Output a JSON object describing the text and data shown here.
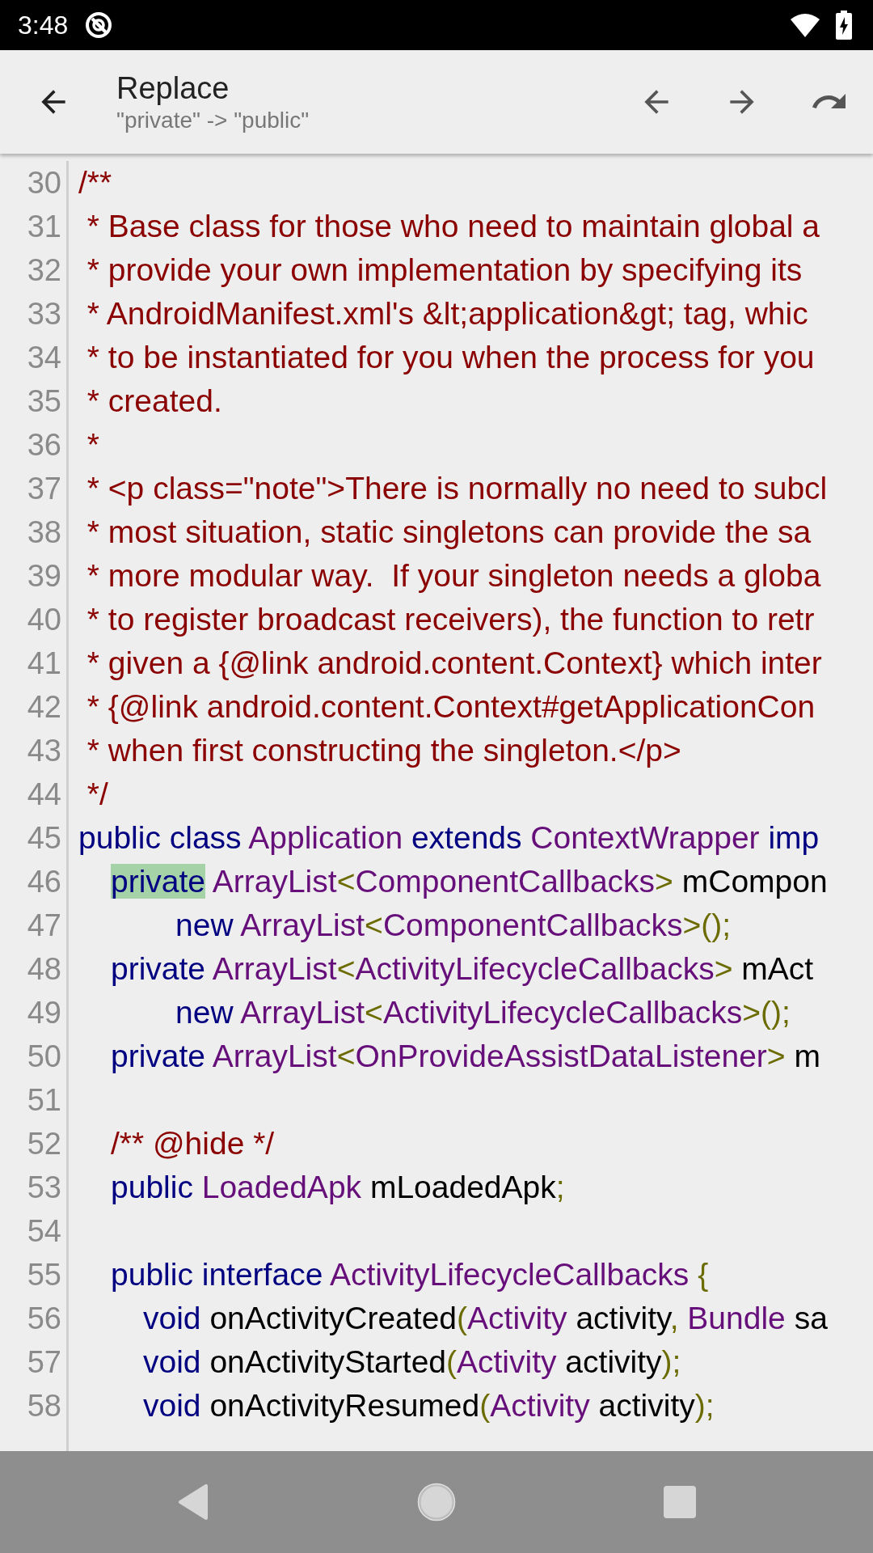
{
  "status_bar": {
    "time": "3:48"
  },
  "toolbar": {
    "title": "Replace",
    "subtitle": "\"private\" -> \"public\""
  },
  "editor": {
    "lines": [
      {
        "number": "30",
        "tokens": [
          {
            "kind": "comment",
            "text": "/**"
          }
        ]
      },
      {
        "number": "31",
        "tokens": [
          {
            "kind": "comment",
            "text": " * Base class for those who need to maintain global a"
          }
        ]
      },
      {
        "number": "32",
        "tokens": [
          {
            "kind": "comment",
            "text": " * provide your own implementation by specifying its"
          }
        ]
      },
      {
        "number": "33",
        "tokens": [
          {
            "kind": "comment",
            "text": " * AndroidManifest.xml's &lt;application&gt; tag, whic"
          }
        ]
      },
      {
        "number": "34",
        "tokens": [
          {
            "kind": "comment",
            "text": " * to be instantiated for you when the process for you"
          }
        ]
      },
      {
        "number": "35",
        "tokens": [
          {
            "kind": "comment",
            "text": " * created."
          }
        ]
      },
      {
        "number": "36",
        "tokens": [
          {
            "kind": "comment",
            "text": " *"
          }
        ]
      },
      {
        "number": "37",
        "tokens": [
          {
            "kind": "comment",
            "text": " * <p class=\"note\">There is normally no need to subcl"
          }
        ]
      },
      {
        "number": "38",
        "tokens": [
          {
            "kind": "comment",
            "text": " * most situation, static singletons can provide the sa"
          }
        ]
      },
      {
        "number": "39",
        "tokens": [
          {
            "kind": "comment",
            "text": " * more modular way.  If your singleton needs a globa"
          }
        ]
      },
      {
        "number": "40",
        "tokens": [
          {
            "kind": "comment",
            "text": " * to register broadcast receivers), the function to retr"
          }
        ]
      },
      {
        "number": "41",
        "tokens": [
          {
            "kind": "comment",
            "text": " * given a {@link android.content.Context} which inter"
          }
        ]
      },
      {
        "number": "42",
        "tokens": [
          {
            "kind": "comment",
            "text": " * {@link android.content.Context#getApplicationCon"
          }
        ]
      },
      {
        "number": "43",
        "tokens": [
          {
            "kind": "comment",
            "text": " * when first constructing the singleton.</p>"
          }
        ]
      },
      {
        "number": "44",
        "tokens": [
          {
            "kind": "comment",
            "text": " */"
          }
        ]
      },
      {
        "number": "45",
        "tokens": [
          {
            "kind": "keyword",
            "text": "public class "
          },
          {
            "kind": "type",
            "text": "Application "
          },
          {
            "kind": "keyword",
            "text": "extends "
          },
          {
            "kind": "type",
            "text": "ContextWrapper "
          },
          {
            "kind": "keyword",
            "text": "imp"
          }
        ]
      },
      {
        "number": "46",
        "kind": "member",
        "tokens": [
          {
            "kind": "keyword",
            "text": "private",
            "highlighted": true
          },
          {
            "kind": "type",
            "text": " ArrayList"
          },
          {
            "kind": "punct",
            "text": "<"
          },
          {
            "kind": "type",
            "text": "ComponentCallbacks"
          },
          {
            "kind": "punct",
            "text": ">"
          },
          {
            "kind": "plain",
            "text": " mCompon"
          }
        ]
      },
      {
        "number": "47",
        "kind": "continuation",
        "tokens": [
          {
            "kind": "keyword",
            "text": "new "
          },
          {
            "kind": "type",
            "text": "ArrayList"
          },
          {
            "kind": "punct",
            "text": "<"
          },
          {
            "kind": "type",
            "text": "ComponentCallbacks"
          },
          {
            "kind": "punct",
            "text": ">();"
          }
        ]
      },
      {
        "number": "48",
        "kind": "member",
        "tokens": [
          {
            "kind": "keyword",
            "text": "private "
          },
          {
            "kind": "type",
            "text": "ArrayList"
          },
          {
            "kind": "punct",
            "text": "<"
          },
          {
            "kind": "type",
            "text": "ActivityLifecycleCallbacks"
          },
          {
            "kind": "punct",
            "text": ">"
          },
          {
            "kind": "plain",
            "text": " mAct"
          }
        ]
      },
      {
        "number": "49",
        "kind": "continuation",
        "tokens": [
          {
            "kind": "keyword",
            "text": "new "
          },
          {
            "kind": "type",
            "text": "ArrayList"
          },
          {
            "kind": "punct",
            "text": "<"
          },
          {
            "kind": "type",
            "text": "ActivityLifecycleCallbacks"
          },
          {
            "kind": "punct",
            "text": ">();"
          }
        ]
      },
      {
        "number": "50",
        "kind": "member",
        "tokens": [
          {
            "kind": "keyword",
            "text": "private "
          },
          {
            "kind": "type",
            "text": "ArrayList"
          },
          {
            "kind": "punct",
            "text": "<"
          },
          {
            "kind": "type",
            "text": "OnProvideAssistDataListener"
          },
          {
            "kind": "punct",
            "text": ">"
          },
          {
            "kind": "plain",
            "text": " m"
          }
        ]
      },
      {
        "number": "51"
      },
      {
        "number": "52",
        "kind": "member",
        "tokens": [
          {
            "kind": "comment",
            "text": "/** @hide */"
          }
        ]
      },
      {
        "number": "53",
        "kind": "member",
        "tokens": [
          {
            "kind": "keyword",
            "text": "public "
          },
          {
            "kind": "type",
            "text": "LoadedApk"
          },
          {
            "kind": "plain",
            "text": " mLoadedApk"
          },
          {
            "kind": "punct",
            "text": ";"
          }
        ]
      },
      {
        "number": "54"
      },
      {
        "number": "55",
        "kind": "member",
        "tokens": [
          {
            "kind": "keyword",
            "text": "public interface "
          },
          {
            "kind": "type",
            "text": "ActivityLifecycleCallbacks"
          },
          {
            "kind": "punct",
            "text": " {"
          }
        ]
      },
      {
        "number": "56",
        "kind": "body",
        "tokens": [
          {
            "kind": "keyword",
            "text": "void"
          },
          {
            "kind": "plain",
            "text": " onActivityCreated"
          },
          {
            "kind": "punct",
            "text": "("
          },
          {
            "kind": "type",
            "text": "Activity"
          },
          {
            "kind": "plain",
            "text": " activity"
          },
          {
            "kind": "punct",
            "text": ", "
          },
          {
            "kind": "type",
            "text": "Bundle"
          },
          {
            "kind": "plain",
            "text": " sa"
          }
        ]
      },
      {
        "number": "57",
        "kind": "body",
        "tokens": [
          {
            "kind": "keyword",
            "text": "void"
          },
          {
            "kind": "plain",
            "text": " onActivityStarted"
          },
          {
            "kind": "punct",
            "text": "("
          },
          {
            "kind": "type",
            "text": "Activity"
          },
          {
            "kind": "plain",
            "text": " activity"
          },
          {
            "kind": "punct",
            "text": ");"
          }
        ]
      },
      {
        "number": "58",
        "kind": "body",
        "tokens": [
          {
            "kind": "keyword",
            "text": "void"
          },
          {
            "kind": "plain",
            "text": " onActivityResumed"
          },
          {
            "kind": "punct",
            "text": "("
          },
          {
            "kind": "type",
            "text": "Activity"
          },
          {
            "kind": "plain",
            "text": " activity"
          },
          {
            "kind": "punct",
            "text": ");"
          }
        ]
      }
    ]
  }
}
